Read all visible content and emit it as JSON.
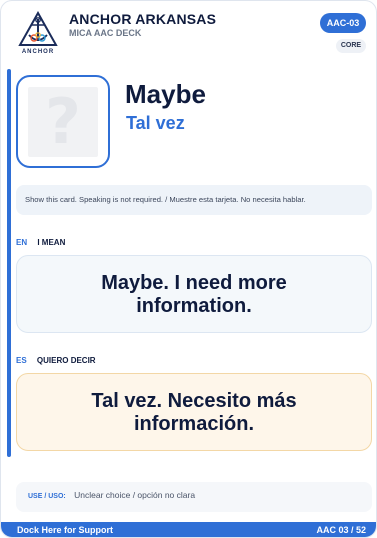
{
  "header": {
    "logo_text": "ANCHOR",
    "org_name": "ANCHOR ARKANSAS",
    "deck_name": "MICA AAC DECK",
    "card_id": "AAC-03",
    "category": "CORE"
  },
  "hero": {
    "icon": "question-mark-icon",
    "word_en": "Maybe",
    "word_es": "Tal vez"
  },
  "instruction": "Show this card. Speaking is not required. / Muestre esta tarjeta. No necesita hablar.",
  "english": {
    "code": "EN",
    "label": "I MEAN",
    "line1": "Maybe. I need more",
    "line2": "information."
  },
  "spanish": {
    "code": "ES",
    "label": "QUIERO DECIR",
    "line1": "Tal vez. Necesito más",
    "line2": "información."
  },
  "use": {
    "label": "USE / USO:",
    "text": "Unclear choice / opción no clara"
  },
  "footer": {
    "left": "Dock Here for Support",
    "right": "AAC 03 / 52"
  },
  "colors": {
    "accent": "#2f6fd6",
    "navy": "#0f1b3d",
    "english_bg": "#f4f8fb",
    "spanish_bg": "#fef6ea"
  }
}
